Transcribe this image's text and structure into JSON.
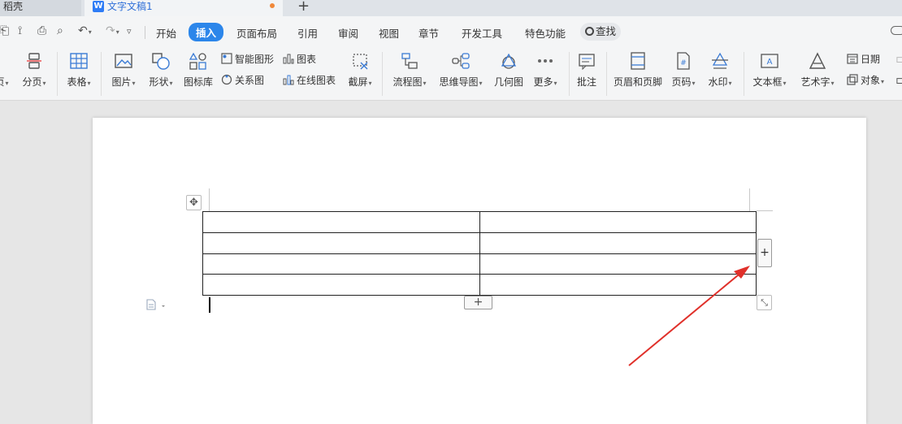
{
  "tabs": {
    "daoke": "稻壳",
    "doc_title": "文字文稿1",
    "add": "+"
  },
  "menu": {
    "items": [
      "开始",
      "插入",
      "页面布局",
      "引用",
      "审阅",
      "视图",
      "章节",
      "开发工具",
      "特色功能"
    ],
    "active": "插入",
    "search": "查找"
  },
  "ribbon": {
    "page_partial": "页",
    "section_break": "分页",
    "table": "表格",
    "picture": "图片",
    "shape": "形状",
    "icon_library": "图标库",
    "smart_art": "智能图形",
    "chart": "图表",
    "relation_chart": "关系图",
    "online_chart": "在线图表",
    "screenshot": "截屏",
    "flowchart": "流程图",
    "mindmap": "思维导图",
    "geometry": "几何图",
    "more": "更多",
    "comment": "批注",
    "header_footer": "页眉和页脚",
    "page_number": "页码",
    "watermark": "水印",
    "text_box": "文本框",
    "word_art": "艺术字",
    "date": "日期",
    "object": "对象"
  },
  "document": {
    "table_rows": 4,
    "table_cols": 2,
    "add_symbol": "+",
    "move_symbol": "✥",
    "resize_symbol": "⤡"
  },
  "colors": {
    "accent": "#2c86ea",
    "arrow": "#e0302a",
    "doc_tab_text": "#2e6fd8"
  }
}
